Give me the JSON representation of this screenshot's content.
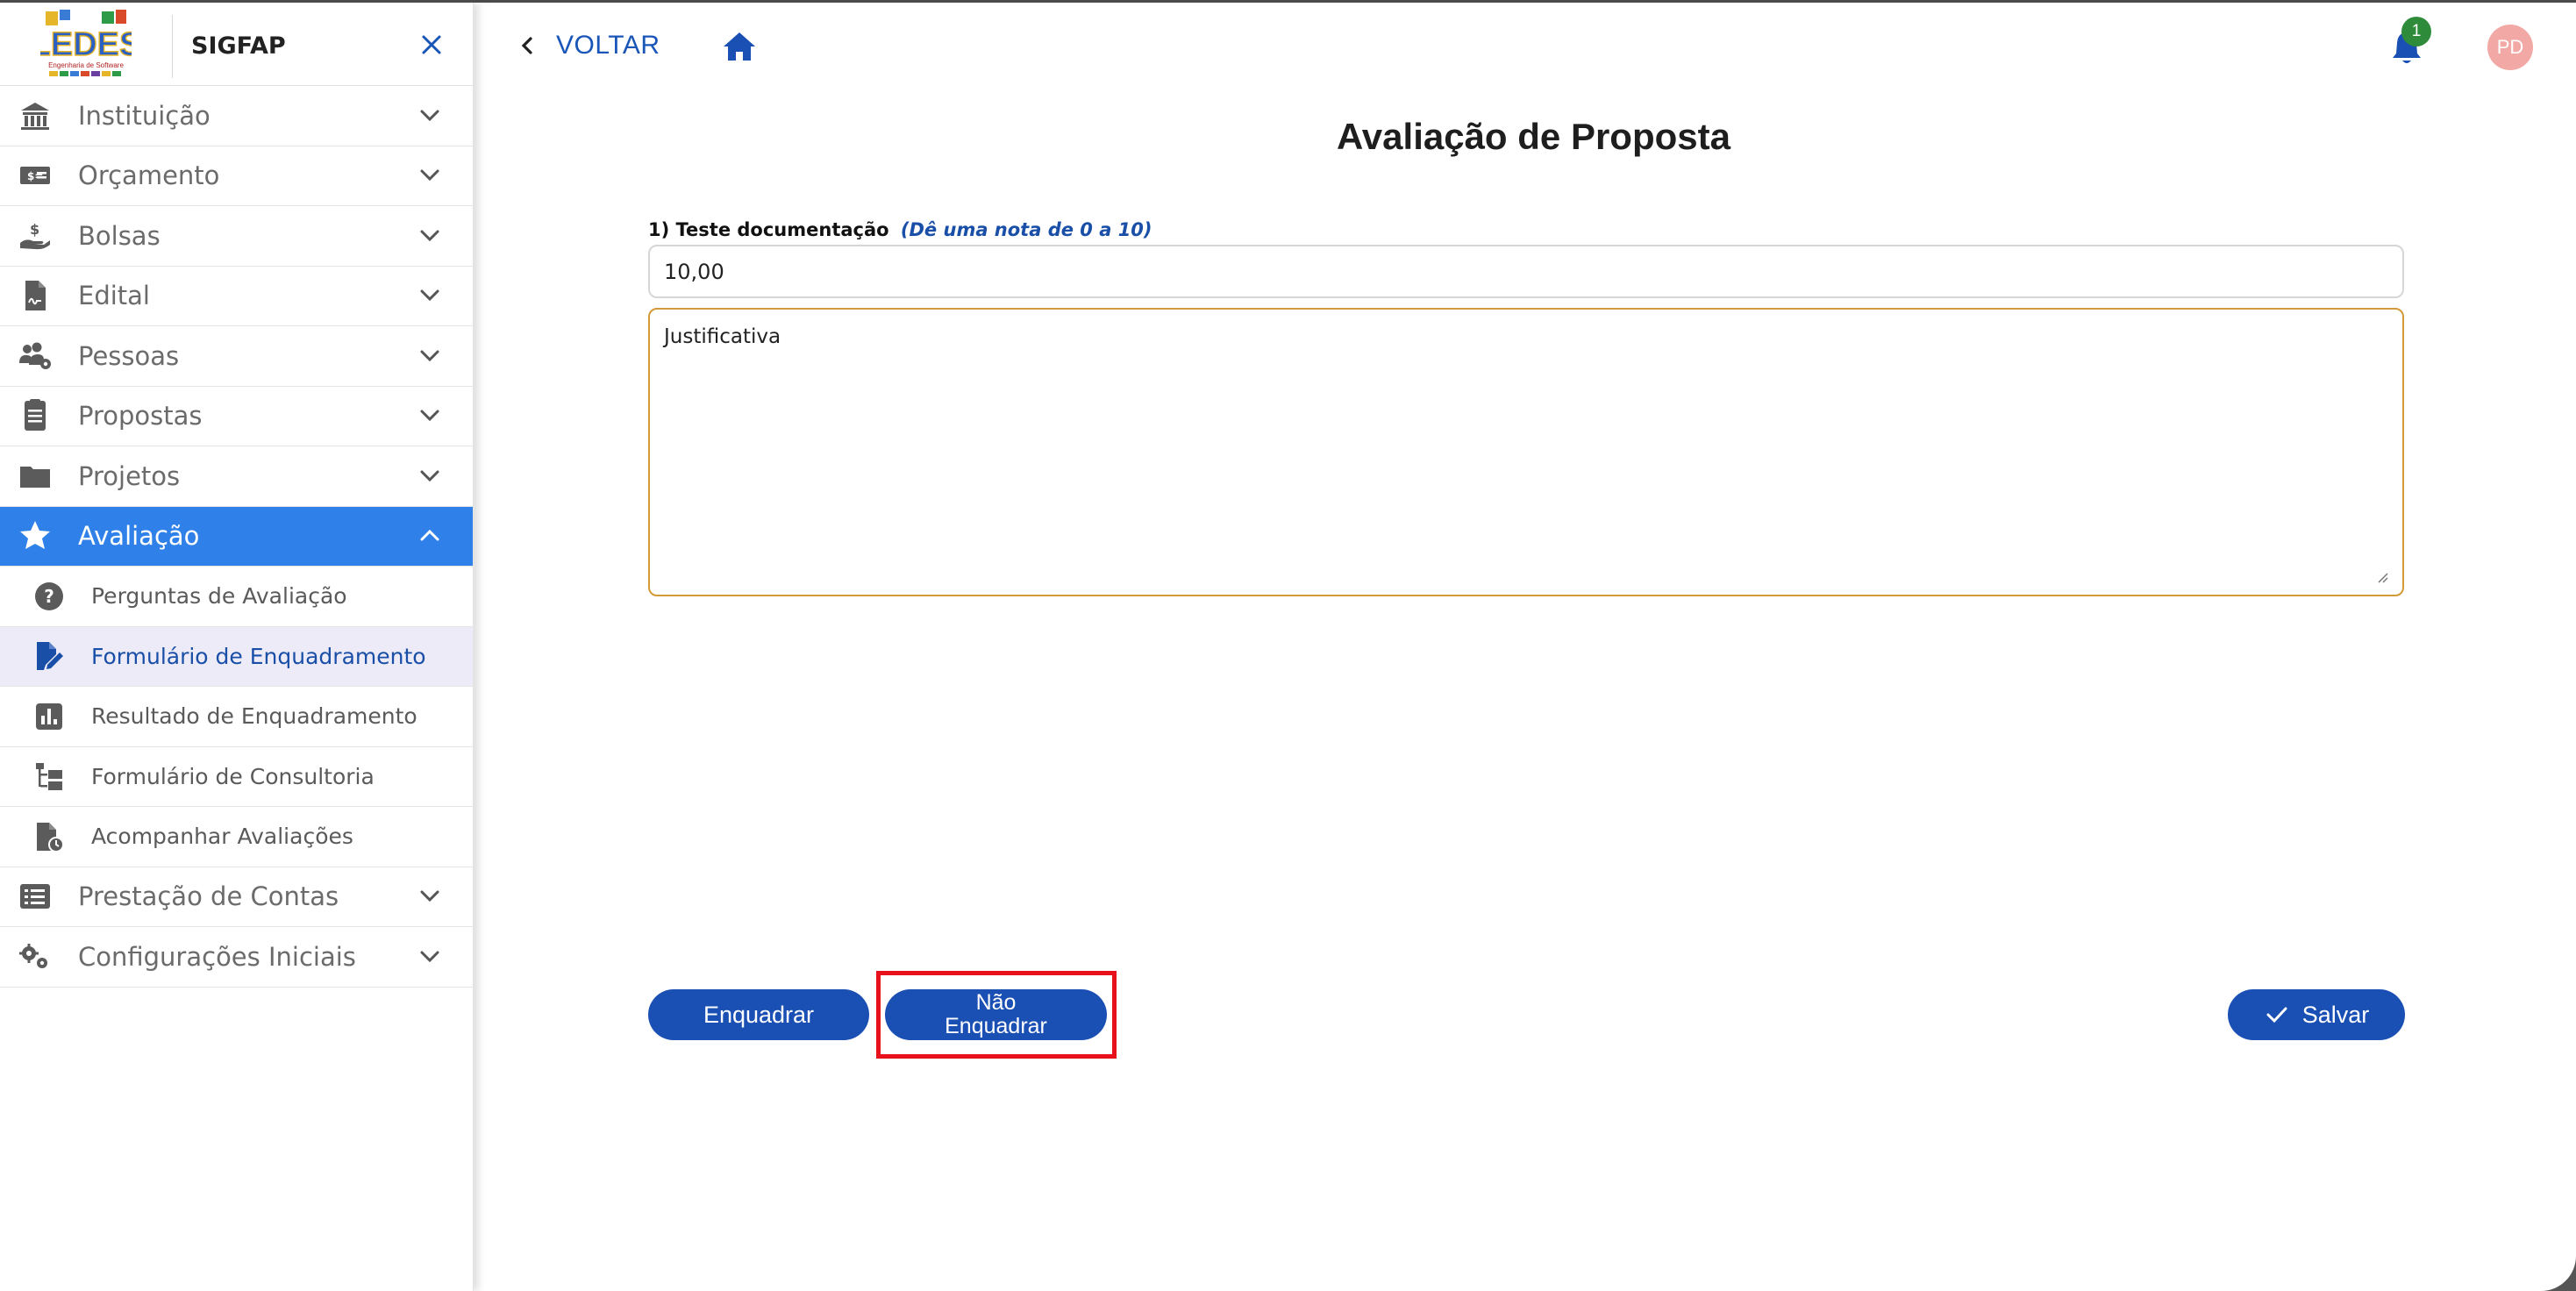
{
  "app": {
    "title": "SIGFAP",
    "logo_text": "LEDES",
    "logo_subtitle": "Engenharia de Software"
  },
  "sidebar": {
    "items": [
      {
        "label": "Instituição",
        "icon": "bank-icon",
        "expanded": false
      },
      {
        "label": "Orçamento",
        "icon": "money-bill-icon",
        "expanded": false
      },
      {
        "label": "Bolsas",
        "icon": "hand-coin-icon",
        "expanded": false
      },
      {
        "label": "Edital",
        "icon": "document-signature-icon",
        "expanded": false
      },
      {
        "label": "Pessoas",
        "icon": "users-gear-icon",
        "expanded": false
      },
      {
        "label": "Propostas",
        "icon": "document-list-icon",
        "expanded": false
      },
      {
        "label": "Projetos",
        "icon": "folder-icon",
        "expanded": false
      },
      {
        "label": "Avaliação",
        "icon": "star-icon",
        "expanded": true,
        "active": true
      },
      {
        "label": "Prestação de Contas",
        "icon": "list-icon",
        "expanded": false
      },
      {
        "label": "Configurações Iniciais",
        "icon": "gears-icon",
        "expanded": false
      }
    ],
    "avaliacao_subitems": [
      {
        "label": "Perguntas de Avaliação",
        "icon": "question-circle-icon"
      },
      {
        "label": "Formulário de Enquadramento",
        "icon": "file-edit-icon",
        "selected": true
      },
      {
        "label": "Resultado de Enquadramento",
        "icon": "bar-chart-icon"
      },
      {
        "label": "Formulário de Consultoria",
        "icon": "tree-structure-icon"
      },
      {
        "label": "Acompanhar Avaliações",
        "icon": "file-clock-icon"
      }
    ]
  },
  "topbar": {
    "back_label": "VOLTAR",
    "notification_count": "1",
    "avatar_initials": "PD"
  },
  "main": {
    "title": "Avaliação de Proposta",
    "question": {
      "label": "1) Teste documentação",
      "hint": "(Dê uma nota de 0 a 10)",
      "value": "10,00",
      "justification_placeholder": "Justificativa"
    },
    "buttons": {
      "enquadrar": "Enquadrar",
      "nao_enquadrar_line1": "Não",
      "nao_enquadrar_line2": "Enquadrar",
      "salvar": "Salvar"
    }
  },
  "colors": {
    "primary": "#1a4fb4",
    "sidebar_active": "#2f80e8",
    "highlight": "#e8101a",
    "textarea_border": "#d39a3a",
    "badge": "#2e8b3a",
    "avatar": "#f2a8a4"
  }
}
